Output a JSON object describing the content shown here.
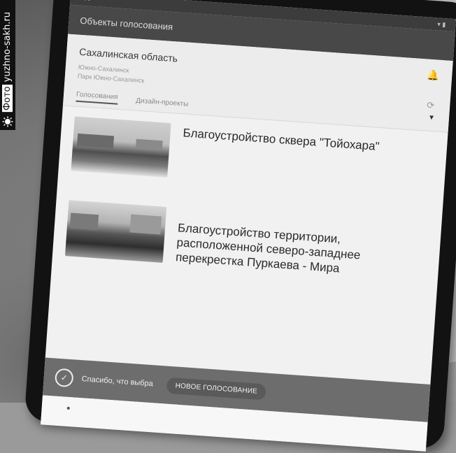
{
  "watermark": {
    "photo_label": "Фото",
    "site": "yuzhno-sakh.ru"
  },
  "app": {
    "title": "Объекты голосования"
  },
  "header": {
    "region": "Сахалинская область",
    "line1": "Южно-Сахалинск",
    "line2": "Парк Южно-Сахалинск"
  },
  "tabs": [
    {
      "label": "Голосования"
    },
    {
      "label": "Дизайн-проекты"
    }
  ],
  "items": [
    {
      "title": "Благоустройство сквера \"Тойохара\""
    },
    {
      "title": "Благоустройство территории, расположенной северо-западнее перекрестка Пуркаева - Мира"
    }
  ],
  "toast": {
    "message": "Спасибо, что выбра",
    "button": "НОВОЕ ГОЛОСОВАНИЕ"
  },
  "icons": {
    "bell": "bell-icon",
    "refresh": "refresh-icon",
    "check": "check-circle-icon",
    "dropdown": "chevron-down-icon"
  }
}
